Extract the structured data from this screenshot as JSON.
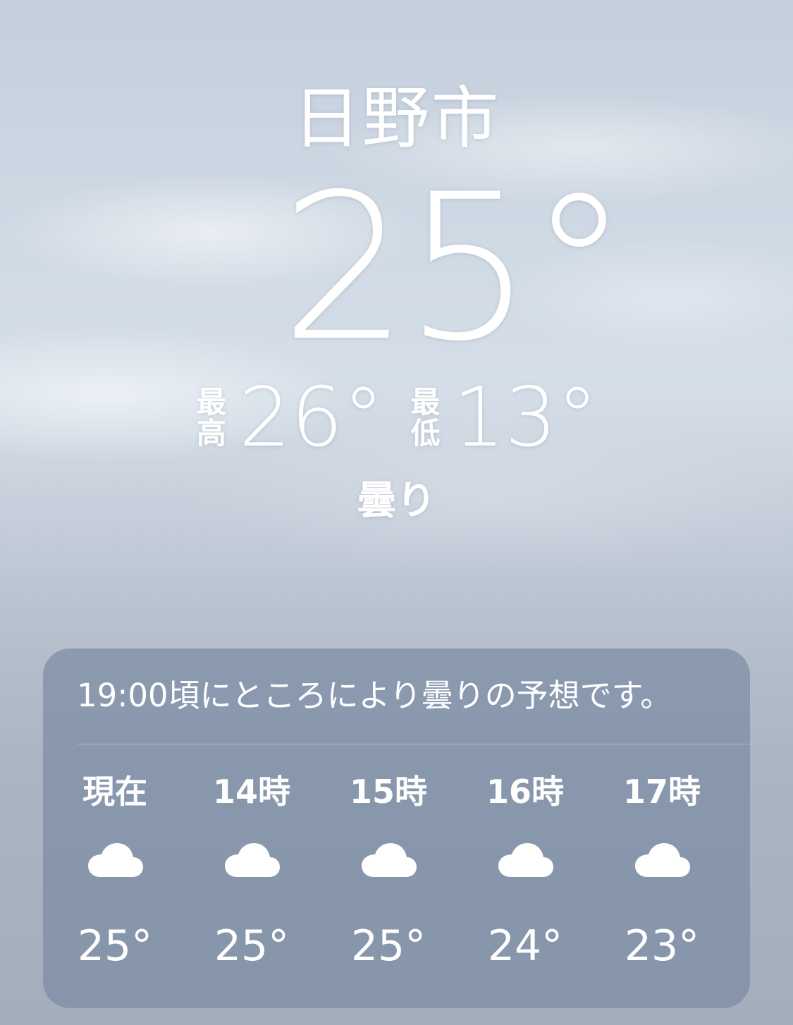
{
  "location": {
    "city": "日野市",
    "current_temp": "25°",
    "high_label": [
      "最",
      "高"
    ],
    "high_temp": "26°",
    "low_label": [
      "最",
      "低"
    ],
    "low_temp": "13°",
    "condition": "曇り"
  },
  "forecast": {
    "summary": "19:00頃にところにより曇りの予想です。",
    "hours": [
      {
        "label": "現在",
        "icon": "cloud-icon",
        "temp": "25°"
      },
      {
        "label": "14時",
        "icon": "cloud-icon",
        "temp": "25°"
      },
      {
        "label": "15時",
        "icon": "cloud-icon",
        "temp": "25°"
      },
      {
        "label": "16時",
        "icon": "cloud-icon",
        "temp": "24°"
      },
      {
        "label": "17時",
        "icon": "cloud-icon",
        "temp": "23°"
      }
    ]
  },
  "colors": {
    "panel": "#7c8ca3",
    "sky_top": "#c4cfdc",
    "sky_bottom": "#a3adbb",
    "text": "#ffffff"
  }
}
